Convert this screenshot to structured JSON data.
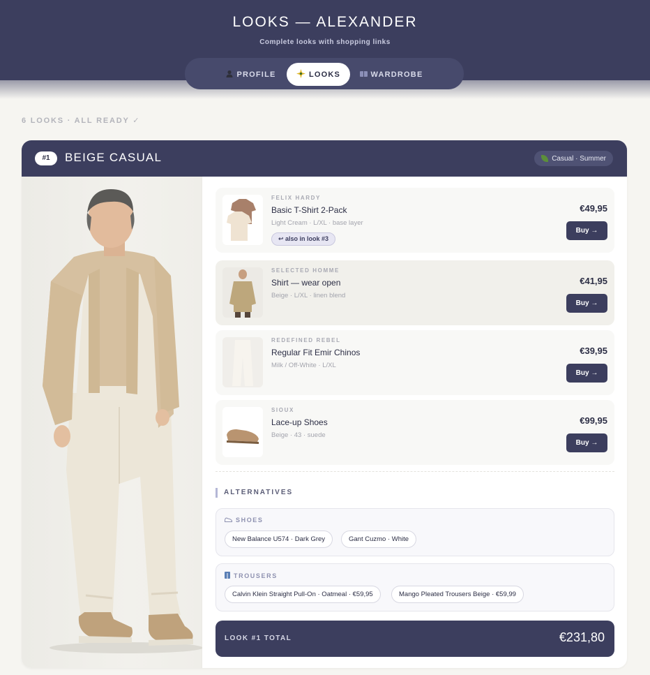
{
  "header": {
    "title": "LOOKS — ALEXANDER",
    "subtitle": "Complete looks with shopping links",
    "tabs": [
      {
        "icon": "person-icon",
        "label": "PROFILE",
        "active": false
      },
      {
        "icon": "sparkle-icon",
        "label": "LOOKS",
        "active": true
      },
      {
        "icon": "wardrobe-icon",
        "label": "WARDROBE",
        "active": false
      }
    ]
  },
  "status": "6 LOOKS · ALL READY ✓",
  "look": {
    "number": "#1",
    "title": "BEIGE CASUAL",
    "tag": "Casual · Summer",
    "items": [
      {
        "brand": "FELIX HARDY",
        "name": "Basic T-Shirt 2-Pack",
        "meta": "Light Cream · L/XL · base layer",
        "reuse": "↩ also in look #3",
        "price": "€49,95",
        "buy": "Buy →"
      },
      {
        "brand": "SELECTED HOMME",
        "name": "Shirt — wear open",
        "meta": "Beige · L/XL · linen blend",
        "price": "€41,95",
        "buy": "Buy →"
      },
      {
        "brand": "REDEFINED REBEL",
        "name": "Regular Fit Emir Chinos",
        "meta": "Milk / Off-White · L/XL",
        "price": "€39,95",
        "buy": "Buy →"
      },
      {
        "brand": "SIOUX",
        "name": "Lace-up Shoes",
        "meta": "Beige · 43 · suede",
        "price": "€99,95",
        "buy": "Buy →"
      }
    ],
    "alternatives": {
      "heading": "ALTERNATIVES",
      "groups": [
        {
          "label": "SHOES",
          "icon": "shoe-icon",
          "chips": [
            "New Balance U574 · Dark Grey",
            "Gant Cuzmo · White"
          ]
        },
        {
          "label": "TROUSERS",
          "icon": "trousers-icon",
          "chips": [
            "Calvin Klein Straight Pull-On · Oatmeal · €59,95",
            "Mango Pleated Trousers Beige · €59,99"
          ]
        }
      ]
    },
    "total_label": "LOOK #1 TOTAL",
    "total_value": "€231,80"
  }
}
